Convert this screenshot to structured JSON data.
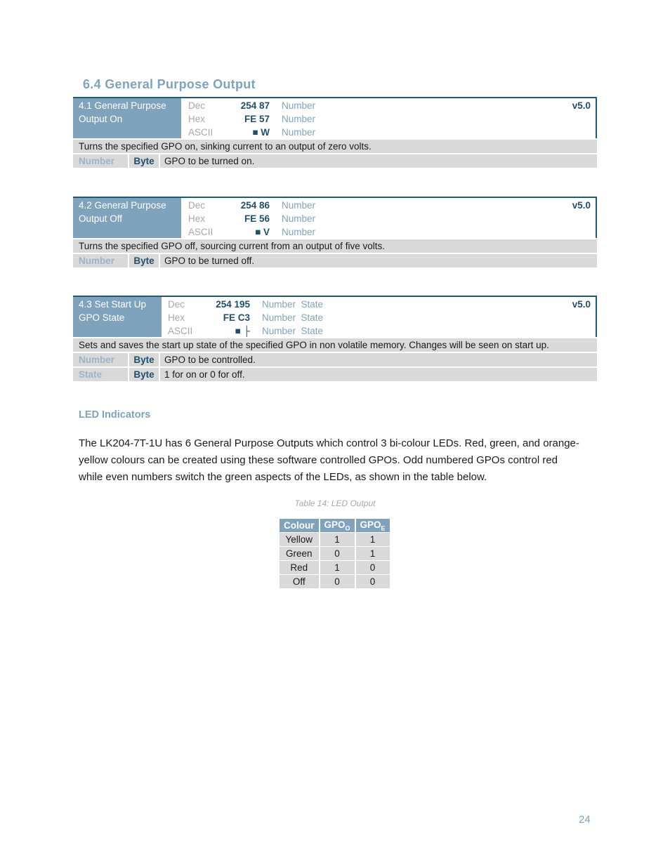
{
  "section_title": "6.4 General Purpose Output",
  "commands": [
    {
      "name_lines": [
        "4.1 General Purpose",
        "Output On"
      ],
      "codes": [
        {
          "label": "Dec",
          "value": "254 87",
          "types": "Number"
        },
        {
          "label": "Hex",
          "value": "FE 57",
          "types": "Number"
        },
        {
          "label": "ASCII",
          "value": "■ W",
          "types": "Number"
        }
      ],
      "version": "v5.0",
      "description": "Turns the specified GPO on, sinking current to an output of zero volts.",
      "params": [
        {
          "name": "Number",
          "type": "Byte",
          "desc": "GPO to be turned on."
        }
      ]
    },
    {
      "name_lines": [
        "4.2 General Purpose",
        "Output Off"
      ],
      "codes": [
        {
          "label": "Dec",
          "value": "254 86",
          "types": "Number"
        },
        {
          "label": "Hex",
          "value": "FE 56",
          "types": "Number"
        },
        {
          "label": "ASCII",
          "value": "■ V",
          "types": "Number"
        }
      ],
      "version": "v5.0",
      "description": "Turns the specified GPO off, sourcing current from an output of five volts.",
      "params": [
        {
          "name": "Number",
          "type": "Byte",
          "desc": "GPO to be turned off."
        }
      ]
    },
    {
      "name_lines": [
        "4.3 Set Start Up",
        "GPO State"
      ],
      "codes": [
        {
          "label": "Dec",
          "value": "254 195",
          "types": "Number  State"
        },
        {
          "label": "Hex",
          "value": "FE C3",
          "types": "Number  State"
        },
        {
          "label": "ASCII",
          "value": "■ ├",
          "types": "Number  State"
        }
      ],
      "version": "v5.0",
      "description": "Sets and saves the start up state of the specified GPO in non volatile memory.  Changes will be seen on start up.",
      "params": [
        {
          "name": "Number",
          "type": "Byte",
          "desc": "GPO to be controlled."
        },
        {
          "name": "State",
          "type": "Byte",
          "desc": "1 for on or 0 for off."
        }
      ]
    }
  ],
  "led": {
    "heading": "LED Indicators",
    "paragraph": "The LK204-7T-1U has 6 General Purpose Outputs which control 3 bi-colour LEDs. Red, green, and orange-yellow colours can be created using these software controlled GPOs. Odd numbered GPOs control red while even numbers switch the green aspects of the LEDs, as shown in the table below.",
    "caption": "Table 14: LED Output",
    "headers": [
      {
        "main": "Colour",
        "sub": ""
      },
      {
        "main": "GPO",
        "sub": "O"
      },
      {
        "main": "GPO",
        "sub": "E"
      }
    ],
    "rows": [
      [
        "Yellow",
        "1",
        "1"
      ],
      [
        "Green",
        "0",
        "1"
      ],
      [
        "Red",
        "1",
        "0"
      ],
      [
        "Off",
        "0",
        "0"
      ]
    ]
  },
  "page_number": "24",
  "colors": {
    "accent": "#7fa3bc",
    "dark_accent": "#1d4f6e",
    "row_gray": "#d9d9d9"
  }
}
